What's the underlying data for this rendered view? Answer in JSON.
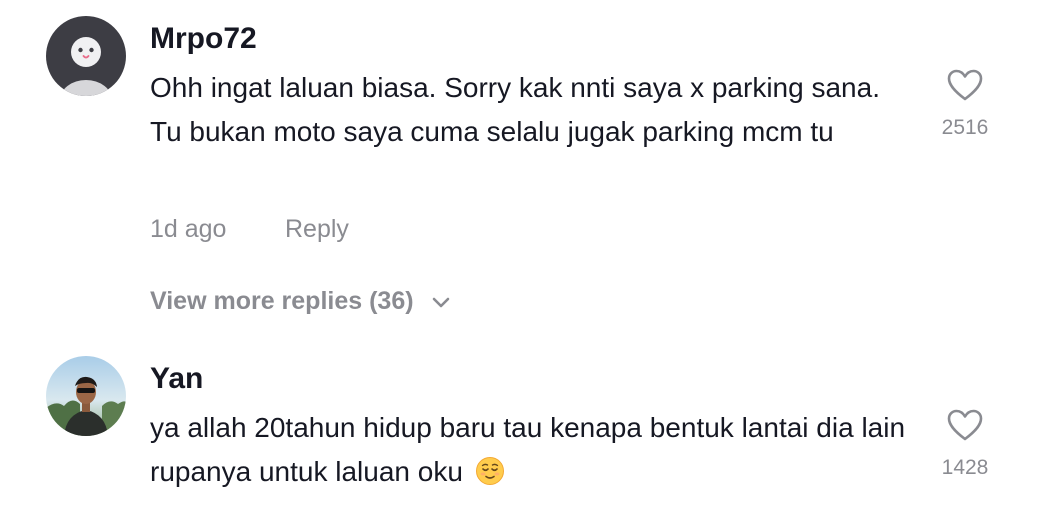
{
  "comments": [
    {
      "username": "Mrpo72",
      "text": "Ohh ingat laluan biasa. Sorry kak nnti saya x parking sana. Tu bukan moto saya cuma selalu jugak parking mcm tu",
      "time": "1d ago",
      "reply_label": "Reply",
      "view_more_label": "View more replies (36)",
      "like_count": "2516",
      "avatar": "default-avatar-icon"
    },
    {
      "username": "Yan",
      "text": "ya allah 20tahun hidup baru tau kenapa bentuk lantai dia lain rupanya untuk laluan oku",
      "emoji": "relieved-face-icon",
      "like_count": "1428",
      "avatar": "user-photo"
    }
  ],
  "colors": {
    "primary_text": "#161823",
    "secondary_text": "#8a8b91",
    "default_avatar_bg": "#3d3d44"
  }
}
